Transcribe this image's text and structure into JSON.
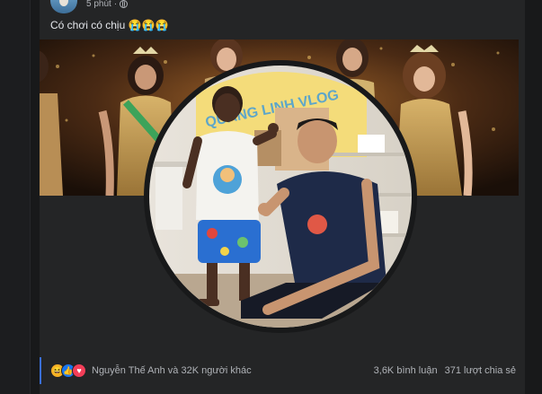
{
  "post": {
    "time": "5 phút",
    "caption": "Có chơi có chịu 😭😭😭"
  },
  "reactions": {
    "icons": [
      "haha-icon",
      "like-icon",
      "love-icon"
    ],
    "colors": {
      "haha": "#f7b125",
      "like": "#1877f2",
      "love": "#f33e58"
    },
    "summary": "Nguyễn Thế Anh và 32K người khác",
    "comments": "3,6K bình luận",
    "shares": "371 lượt chia sẻ"
  },
  "overlay": {
    "sign_text": "QUANG LINH VLOG"
  },
  "colors": {
    "background": "#18191a",
    "card": "#242526",
    "accent": "#3a6fd8"
  }
}
